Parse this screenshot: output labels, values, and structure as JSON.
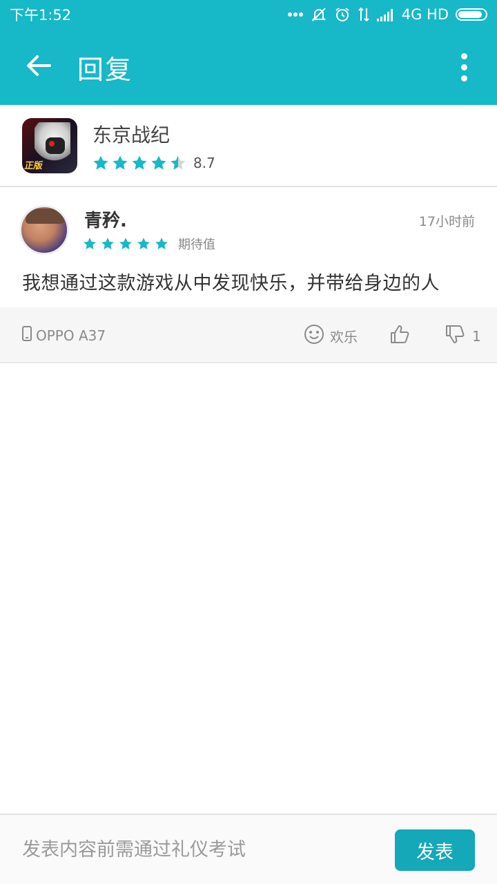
{
  "status_bar": {
    "time": "下午1:52",
    "network": "4G HD",
    "battery_level": 0.9
  },
  "app_bar": {
    "title": "回复",
    "back_icon": "arrow-left-icon",
    "menu_icon": "more-vertical-icon"
  },
  "game": {
    "name": "东京战纪",
    "score": "8.7",
    "stars": 4.5,
    "icon_badge": "正版"
  },
  "review": {
    "user_name": "青矜.",
    "time": "17小时前",
    "stars": 5,
    "rating_tag": "期待值",
    "text": "我想通过这款游戏从中发现快乐，并带给身边的人"
  },
  "actions": {
    "device": "OPPO A37",
    "mood": "欢乐",
    "dislike_count": "1"
  },
  "comment": {
    "placeholder": "发表内容前需通过礼仪考试",
    "submit_label": "发表"
  },
  "colors": {
    "primary": "#17b8c8",
    "star": "#17b8c8",
    "button": "#15a8b8"
  }
}
